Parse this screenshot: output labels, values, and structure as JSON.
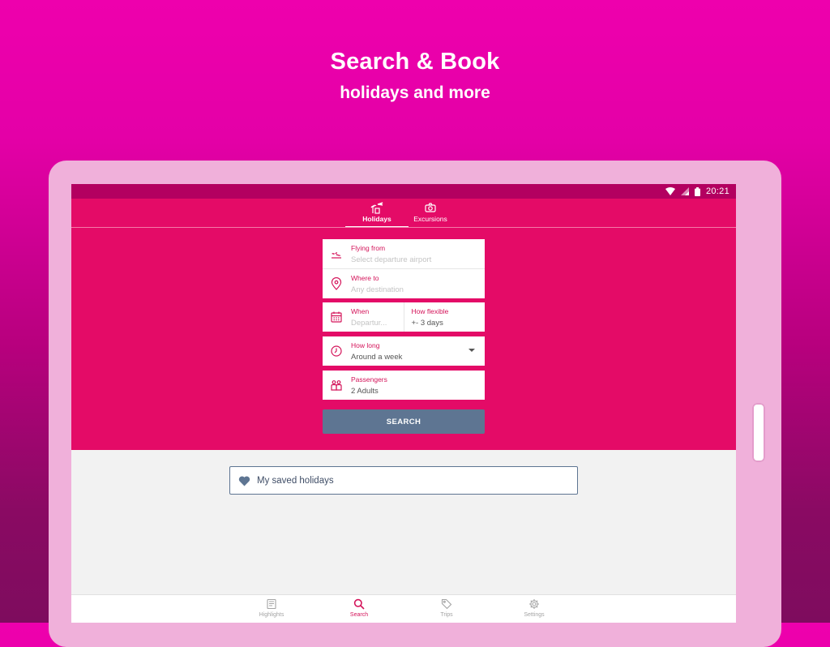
{
  "promo": {
    "title": "Search & Book",
    "subtitle": "holidays and more"
  },
  "status_bar": {
    "time": "20:21",
    "icons": [
      "wifi-icon",
      "signal-icon",
      "battery-icon"
    ]
  },
  "tabs": [
    {
      "label": "Holidays",
      "icon": "palm-plane-icon",
      "active": true
    },
    {
      "label": "Excursions",
      "icon": "camera-icon",
      "active": false
    }
  ],
  "form": {
    "flying_from": {
      "label": "Flying from",
      "placeholder": "Select departure airport",
      "icon": "plane-departure-icon"
    },
    "where_to": {
      "label": "Where to",
      "placeholder": "Any destination",
      "icon": "location-pin-icon"
    },
    "when": {
      "label": "When",
      "placeholder": "Departur...",
      "icon": "calendar-icon"
    },
    "how_flexible": {
      "label": "How flexible",
      "value": "+- 3 days"
    },
    "how_long": {
      "label": "How long",
      "value": "Around a week",
      "icon": "clock-icon"
    },
    "passengers": {
      "label": "Passengers",
      "value": "2 Adults",
      "icon": "passengers-icon"
    },
    "search_label": "SEARCH"
  },
  "saved_holidays": {
    "label": "My saved holidays",
    "icon": "heart-icon"
  },
  "bottom_nav": [
    {
      "label": "Highlights",
      "icon": "newspaper-icon",
      "active": false
    },
    {
      "label": "Search",
      "icon": "search-icon",
      "active": true
    },
    {
      "label": "Trips",
      "icon": "tag-icon",
      "active": false
    },
    {
      "label": "Settings",
      "icon": "gear-icon",
      "active": false
    }
  ],
  "colors": {
    "brand_pink": "#e40b67",
    "status_bar": "#b30060",
    "accent_label": "#d4145a",
    "button": "#5e7592"
  }
}
